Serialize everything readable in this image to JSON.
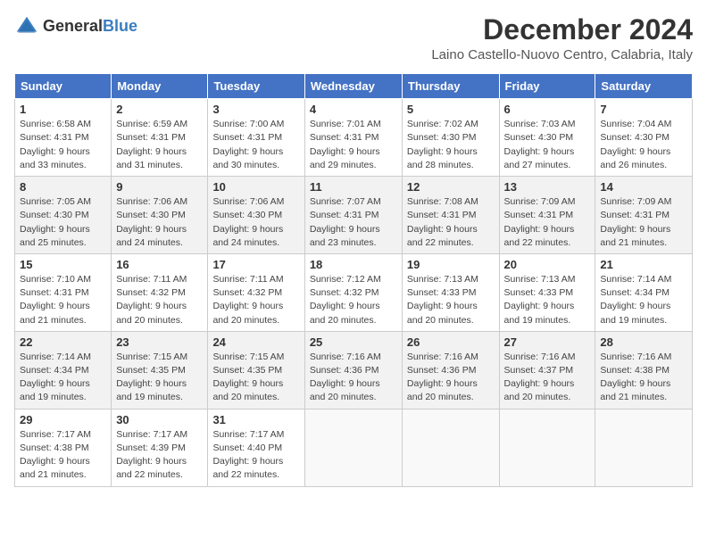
{
  "header": {
    "logo_general": "General",
    "logo_blue": "Blue",
    "month": "December 2024",
    "location": "Laino Castello-Nuovo Centro, Calabria, Italy"
  },
  "columns": [
    "Sunday",
    "Monday",
    "Tuesday",
    "Wednesday",
    "Thursday",
    "Friday",
    "Saturday"
  ],
  "weeks": [
    [
      {
        "day": "1",
        "sunrise": "Sunrise: 6:58 AM",
        "sunset": "Sunset: 4:31 PM",
        "daylight": "Daylight: 9 hours and 33 minutes."
      },
      {
        "day": "2",
        "sunrise": "Sunrise: 6:59 AM",
        "sunset": "Sunset: 4:31 PM",
        "daylight": "Daylight: 9 hours and 31 minutes."
      },
      {
        "day": "3",
        "sunrise": "Sunrise: 7:00 AM",
        "sunset": "Sunset: 4:31 PM",
        "daylight": "Daylight: 9 hours and 30 minutes."
      },
      {
        "day": "4",
        "sunrise": "Sunrise: 7:01 AM",
        "sunset": "Sunset: 4:31 PM",
        "daylight": "Daylight: 9 hours and 29 minutes."
      },
      {
        "day": "5",
        "sunrise": "Sunrise: 7:02 AM",
        "sunset": "Sunset: 4:30 PM",
        "daylight": "Daylight: 9 hours and 28 minutes."
      },
      {
        "day": "6",
        "sunrise": "Sunrise: 7:03 AM",
        "sunset": "Sunset: 4:30 PM",
        "daylight": "Daylight: 9 hours and 27 minutes."
      },
      {
        "day": "7",
        "sunrise": "Sunrise: 7:04 AM",
        "sunset": "Sunset: 4:30 PM",
        "daylight": "Daylight: 9 hours and 26 minutes."
      }
    ],
    [
      {
        "day": "8",
        "sunrise": "Sunrise: 7:05 AM",
        "sunset": "Sunset: 4:30 PM",
        "daylight": "Daylight: 9 hours and 25 minutes."
      },
      {
        "day": "9",
        "sunrise": "Sunrise: 7:06 AM",
        "sunset": "Sunset: 4:30 PM",
        "daylight": "Daylight: 9 hours and 24 minutes."
      },
      {
        "day": "10",
        "sunrise": "Sunrise: 7:06 AM",
        "sunset": "Sunset: 4:30 PM",
        "daylight": "Daylight: 9 hours and 24 minutes."
      },
      {
        "day": "11",
        "sunrise": "Sunrise: 7:07 AM",
        "sunset": "Sunset: 4:31 PM",
        "daylight": "Daylight: 9 hours and 23 minutes."
      },
      {
        "day": "12",
        "sunrise": "Sunrise: 7:08 AM",
        "sunset": "Sunset: 4:31 PM",
        "daylight": "Daylight: 9 hours and 22 minutes."
      },
      {
        "day": "13",
        "sunrise": "Sunrise: 7:09 AM",
        "sunset": "Sunset: 4:31 PM",
        "daylight": "Daylight: 9 hours and 22 minutes."
      },
      {
        "day": "14",
        "sunrise": "Sunrise: 7:09 AM",
        "sunset": "Sunset: 4:31 PM",
        "daylight": "Daylight: 9 hours and 21 minutes."
      }
    ],
    [
      {
        "day": "15",
        "sunrise": "Sunrise: 7:10 AM",
        "sunset": "Sunset: 4:31 PM",
        "daylight": "Daylight: 9 hours and 21 minutes."
      },
      {
        "day": "16",
        "sunrise": "Sunrise: 7:11 AM",
        "sunset": "Sunset: 4:32 PM",
        "daylight": "Daylight: 9 hours and 20 minutes."
      },
      {
        "day": "17",
        "sunrise": "Sunrise: 7:11 AM",
        "sunset": "Sunset: 4:32 PM",
        "daylight": "Daylight: 9 hours and 20 minutes."
      },
      {
        "day": "18",
        "sunrise": "Sunrise: 7:12 AM",
        "sunset": "Sunset: 4:32 PM",
        "daylight": "Daylight: 9 hours and 20 minutes."
      },
      {
        "day": "19",
        "sunrise": "Sunrise: 7:13 AM",
        "sunset": "Sunset: 4:33 PM",
        "daylight": "Daylight: 9 hours and 20 minutes."
      },
      {
        "day": "20",
        "sunrise": "Sunrise: 7:13 AM",
        "sunset": "Sunset: 4:33 PM",
        "daylight": "Daylight: 9 hours and 19 minutes."
      },
      {
        "day": "21",
        "sunrise": "Sunrise: 7:14 AM",
        "sunset": "Sunset: 4:34 PM",
        "daylight": "Daylight: 9 hours and 19 minutes."
      }
    ],
    [
      {
        "day": "22",
        "sunrise": "Sunrise: 7:14 AM",
        "sunset": "Sunset: 4:34 PM",
        "daylight": "Daylight: 9 hours and 19 minutes."
      },
      {
        "day": "23",
        "sunrise": "Sunrise: 7:15 AM",
        "sunset": "Sunset: 4:35 PM",
        "daylight": "Daylight: 9 hours and 19 minutes."
      },
      {
        "day": "24",
        "sunrise": "Sunrise: 7:15 AM",
        "sunset": "Sunset: 4:35 PM",
        "daylight": "Daylight: 9 hours and 20 minutes."
      },
      {
        "day": "25",
        "sunrise": "Sunrise: 7:16 AM",
        "sunset": "Sunset: 4:36 PM",
        "daylight": "Daylight: 9 hours and 20 minutes."
      },
      {
        "day": "26",
        "sunrise": "Sunrise: 7:16 AM",
        "sunset": "Sunset: 4:36 PM",
        "daylight": "Daylight: 9 hours and 20 minutes."
      },
      {
        "day": "27",
        "sunrise": "Sunrise: 7:16 AM",
        "sunset": "Sunset: 4:37 PM",
        "daylight": "Daylight: 9 hours and 20 minutes."
      },
      {
        "day": "28",
        "sunrise": "Sunrise: 7:16 AM",
        "sunset": "Sunset: 4:38 PM",
        "daylight": "Daylight: 9 hours and 21 minutes."
      }
    ],
    [
      {
        "day": "29",
        "sunrise": "Sunrise: 7:17 AM",
        "sunset": "Sunset: 4:38 PM",
        "daylight": "Daylight: 9 hours and 21 minutes."
      },
      {
        "day": "30",
        "sunrise": "Sunrise: 7:17 AM",
        "sunset": "Sunset: 4:39 PM",
        "daylight": "Daylight: 9 hours and 22 minutes."
      },
      {
        "day": "31",
        "sunrise": "Sunrise: 7:17 AM",
        "sunset": "Sunset: 4:40 PM",
        "daylight": "Daylight: 9 hours and 22 minutes."
      },
      null,
      null,
      null,
      null
    ]
  ]
}
